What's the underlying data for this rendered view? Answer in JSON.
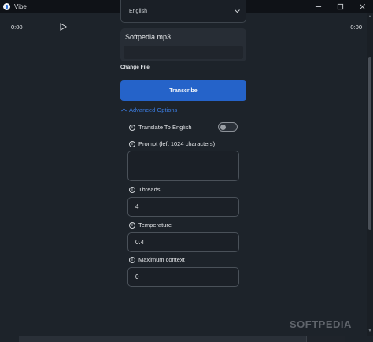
{
  "window": {
    "title": "Vibe"
  },
  "language": {
    "selected": "English"
  },
  "audio": {
    "file_name": "Softpedia.mp3",
    "current_time": "0:00",
    "duration": "0:00"
  },
  "change_file_label": "Change File",
  "transcribe_label": "Transcribe",
  "advanced": {
    "toggle_label": "Advanced Options",
    "translate_label": "Translate To English",
    "translate_enabled": false,
    "prompt_label": "Prompt (left 1024 characters)",
    "prompt_value": "",
    "threads_label": "Threads",
    "threads_value": "4",
    "temperature_label": "Temperature",
    "temperature_value": "0.4",
    "max_context_label": "Maximum context",
    "max_context_value": "0"
  },
  "watermark": "SOFTPEDIA",
  "colors": {
    "accent": "#2563c9",
    "link": "#3b7ce0",
    "background": "#1d232a"
  }
}
